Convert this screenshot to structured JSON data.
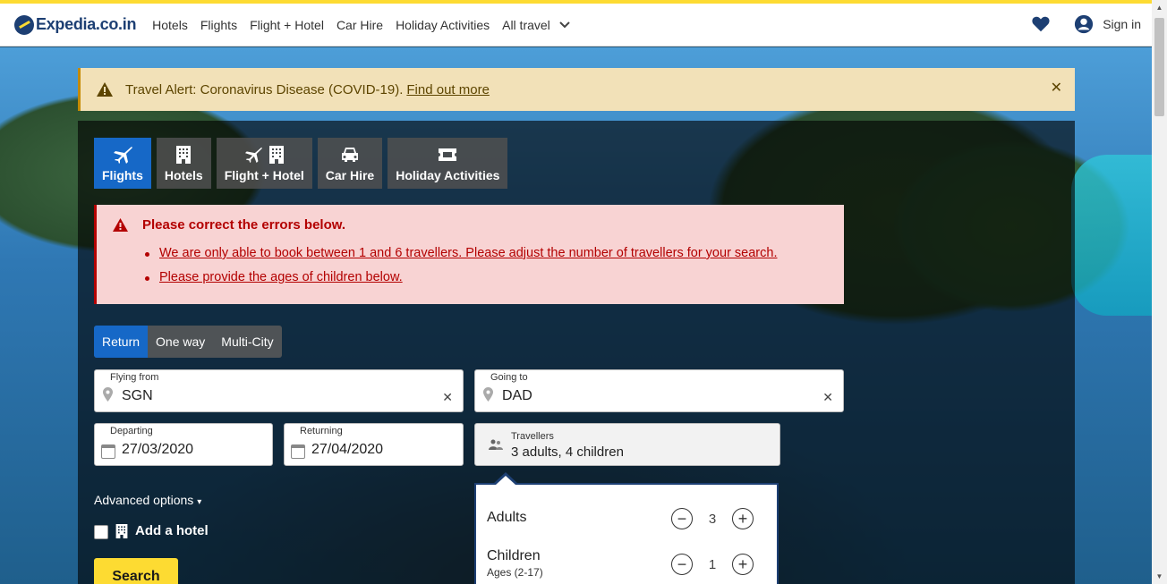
{
  "header": {
    "logo_text": "Expedia.co.in",
    "nav": [
      "Hotels",
      "Flights",
      "Flight + Hotel",
      "Car Hire",
      "Holiday Activities"
    ],
    "all_travel": "All travel",
    "sign_in": "Sign in"
  },
  "alert": {
    "text": "Travel Alert: Coronavirus Disease (COVID-19).",
    "link": "Find out more"
  },
  "tabs": [
    {
      "label": "Flights",
      "icon": "plane-icon",
      "active": true
    },
    {
      "label": "Hotels",
      "icon": "building-icon"
    },
    {
      "label": "Flight + Hotel",
      "icon": "plane-building-icon"
    },
    {
      "label": "Car Hire",
      "icon": "car-icon"
    },
    {
      "label": "Holiday Activities",
      "icon": "ticket-icon"
    }
  ],
  "errors": {
    "title": "Please correct the errors below.",
    "items": [
      "We are only able to book between 1 and 6 travellers. Please adjust the number of travellers for your search.",
      "Please provide the ages of children below."
    ]
  },
  "trip_type": {
    "options": [
      "Return",
      "One way",
      "Multi-City"
    ],
    "selected": "Return"
  },
  "form": {
    "from_label": "Flying from",
    "from_value": "SGN",
    "to_label": "Going to",
    "to_value": "DAD",
    "depart_label": "Departing",
    "depart_value": "27/03/2020",
    "return_label": "Returning",
    "return_value": "27/04/2020",
    "travellers_label": "Travellers",
    "travellers_value": "3 adults, 4 children"
  },
  "advanced_options": "Advanced options",
  "add_hotel": "Add a hotel",
  "search_button": "Search",
  "travellers_popover": {
    "adults_label": "Adults",
    "adults_value": "3",
    "children_label": "Children",
    "children_ages": "Ages (2-17)",
    "children_value": "1"
  },
  "colors": {
    "brand_yellow": "#fddb32",
    "brand_blue": "#1d3f73",
    "active_tab": "#1668c7",
    "error_red": "#b30000"
  }
}
